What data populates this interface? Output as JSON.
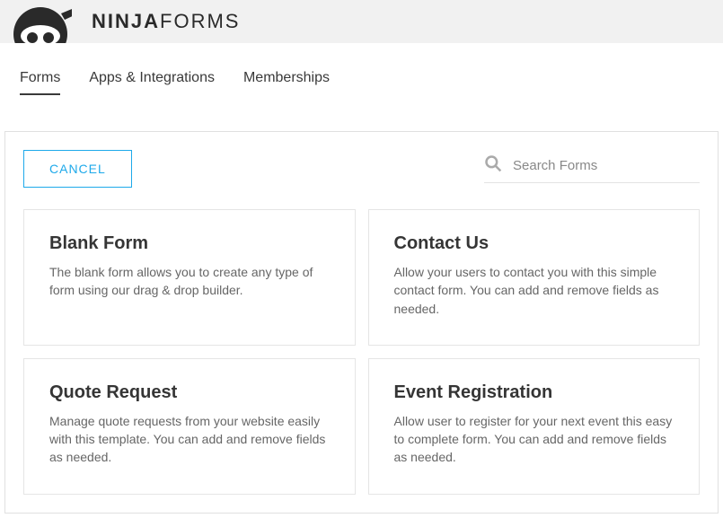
{
  "header": {
    "brand_bold": "NINJA",
    "brand_light": "FORMS"
  },
  "nav": {
    "tabs": [
      {
        "label": "Forms",
        "active": true
      },
      {
        "label": "Apps & Integrations",
        "active": false
      },
      {
        "label": "Memberships",
        "active": false
      }
    ]
  },
  "actions": {
    "cancel_label": "CANCEL"
  },
  "search": {
    "placeholder": "Search Forms"
  },
  "templates": [
    {
      "title": "Blank Form",
      "desc": "The blank form allows you to create any type of form using our drag & drop builder."
    },
    {
      "title": "Contact Us",
      "desc": "Allow your users to contact you with this simple contact form. You can add and remove fields as needed."
    },
    {
      "title": "Quote Request",
      "desc": "Manage quote requests from your website easily with this template. You can add and remove fields as needed."
    },
    {
      "title": "Event Registration",
      "desc": "Allow user to register for your next event this easy to complete form. You can add and remove fields as needed."
    }
  ]
}
